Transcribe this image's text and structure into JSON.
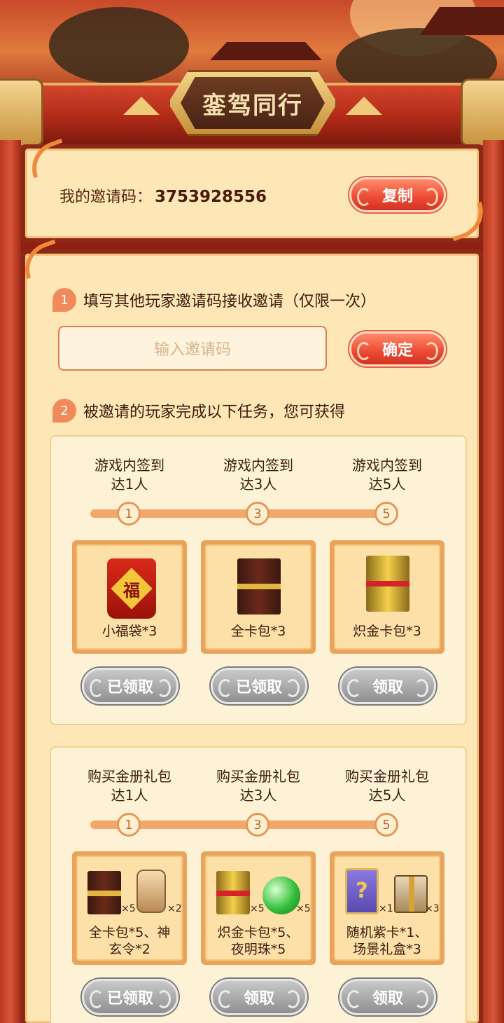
{
  "header": {
    "title": "銮驾同行"
  },
  "invite": {
    "label": "我的邀请码：",
    "code": "3753928556",
    "copy_label": "复制"
  },
  "accept": {
    "step_number": "1",
    "step_text": "填写其他玩家邀请码接收邀请（仅限一次）",
    "input_placeholder": "输入邀请码",
    "confirm_label": "确定"
  },
  "rewards_intro": {
    "step_number": "2",
    "step_text": "被邀请的玩家完成以下任务，您可获得"
  },
  "checkin": {
    "tiers": [
      {
        "label_line1": "游戏内签到",
        "label_line2": "达1人",
        "node": "1",
        "reward": "小福袋*3",
        "button": "已领取",
        "icon": "lucky-bag-icon"
      },
      {
        "label_line1": "游戏内签到",
        "label_line2": "达3人",
        "node": "3",
        "reward": "全卡包*3",
        "button": "已领取",
        "icon": "card-pack-icon"
      },
      {
        "label_line1": "游戏内签到",
        "label_line2": "达5人",
        "node": "5",
        "reward": "炽金卡包*3",
        "button": "领取",
        "icon": "gold-card-pack-icon"
      }
    ],
    "fu_char": "福"
  },
  "purchase": {
    "tiers": [
      {
        "label_line1": "购买金册礼包",
        "label_line2": "达1人",
        "node": "1",
        "reward_line1": "全卡包*5、神",
        "reward_line2": "玄令*2",
        "qty_a": "×5",
        "qty_b": "×2",
        "button": "已领取"
      },
      {
        "label_line1": "购买金册礼包",
        "label_line2": "达3人",
        "node": "3",
        "reward_line1": "炽金卡包*5、",
        "reward_line2": "夜明珠*5",
        "qty_a": "×5",
        "qty_b": "×5",
        "button": "领取"
      },
      {
        "label_line1": "购买金册礼包",
        "label_line2": "达5人",
        "node": "5",
        "reward_line1": "随机紫卡*1、",
        "reward_line2": "场景礼盒*3",
        "qty_a": "×1",
        "qty_b": "×3",
        "button": "领取"
      }
    ],
    "mystery_mark": "?"
  },
  "colors": {
    "accent_red": "#ec4a34",
    "panel_cream": "#fde7b6",
    "frame_red": "#8c2a17",
    "button_grey": "#a8a8a8"
  }
}
